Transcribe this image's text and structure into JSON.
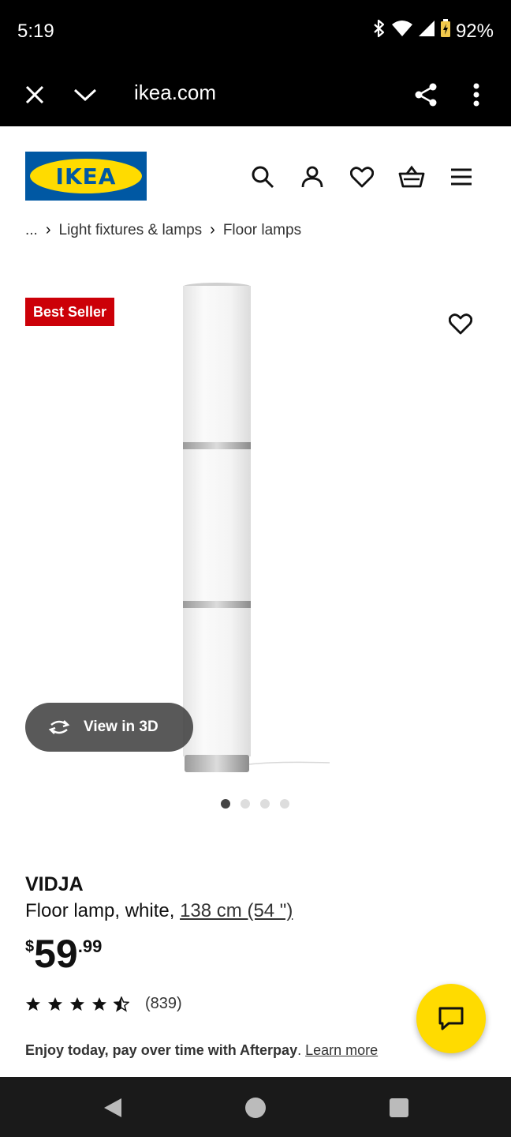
{
  "status": {
    "time": "5:19",
    "battery": "92%"
  },
  "browser": {
    "url": "ikea.com"
  },
  "logo": {
    "text": "IKEA"
  },
  "breadcrumb": {
    "ellipsis": "...",
    "items": [
      "Light fixtures & lamps",
      "Floor lamps"
    ]
  },
  "product": {
    "badge": "Best Seller",
    "view3d_label": "View in 3D",
    "name": "VIDJA",
    "description": "Floor lamp, white,",
    "size_link": "138 cm (54 \")",
    "price": {
      "currency": "$",
      "integer": "59",
      "decimal": ".99"
    },
    "rating": {
      "value": 4.5,
      "count": "(839)"
    },
    "afterpay": {
      "text": "Enjoy today, pay over time with Afterpay",
      "period": ".",
      "link": "Learn more"
    },
    "gallery": {
      "total": 4,
      "active": 1
    }
  },
  "colors": {
    "brand_blue": "#0058a3",
    "brand_yellow": "#ffdb00",
    "badge_red": "#cc0008"
  }
}
